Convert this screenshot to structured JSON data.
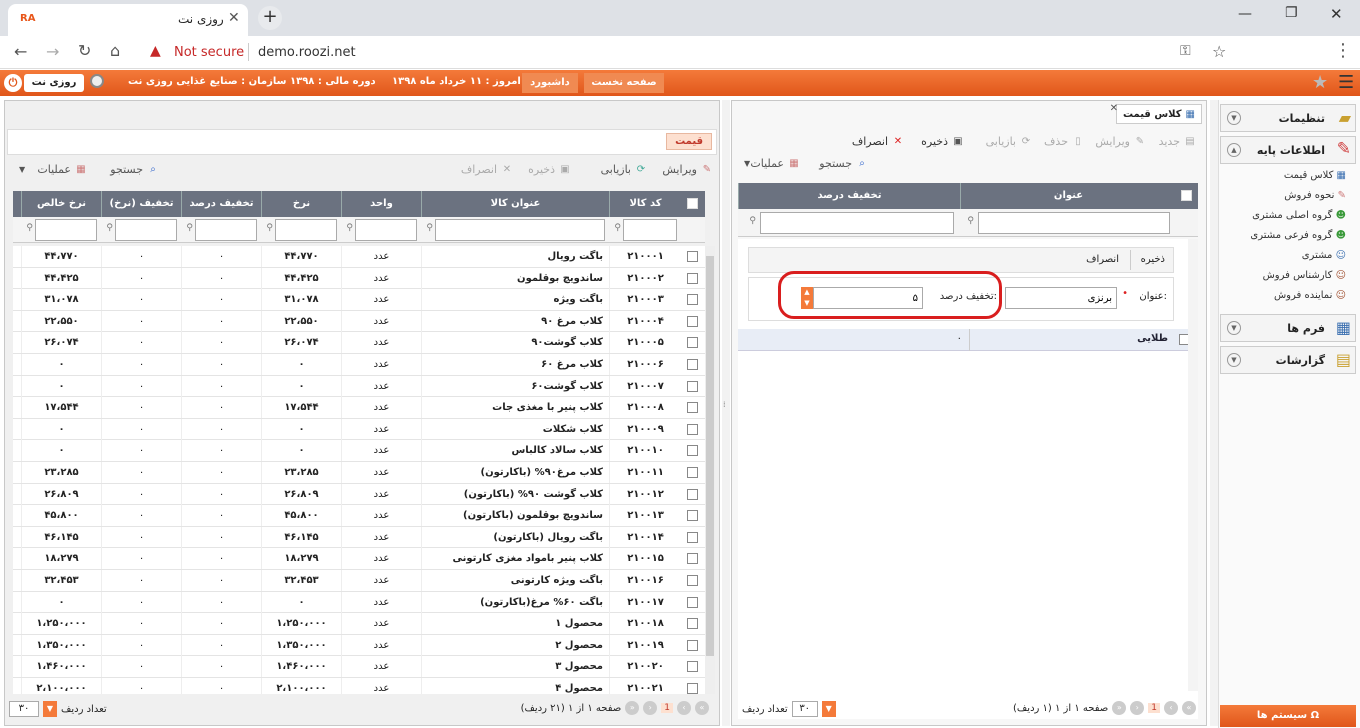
{
  "browser": {
    "tab_title": "روزی نت",
    "security": "Not secure",
    "url": "demo.roozi.net"
  },
  "header": {
    "user_label": "روزی نت",
    "org": "سازمان : صنایع غذایی روزی نت",
    "fiscal": "دوره مالی : ۱۳۹۸",
    "today": "امروز : ۱۱ خرداد ماه ۱۳۹۸",
    "dashboard": "داشبورد",
    "first_page": "صفحه نخست"
  },
  "sidebar": {
    "settings": "تنظیمات",
    "basic": "اطلاعات پایه",
    "items": [
      "کلاس قیمت",
      "نحوه فروش",
      "گروه اصلی مشتری",
      "گروه فرعی مشتری",
      "مشتری",
      "کارشناس فروش",
      "نماینده فروش"
    ],
    "forms": "فرم ها",
    "reports": "گزارشات",
    "system_menu": "سیستم ها"
  },
  "mid": {
    "tab": "کلاس قیمت",
    "tb": {
      "new": "جدید",
      "edit": "ویرایش",
      "delete": "حذف",
      "refresh": "بازیابی",
      "save": "ذخیره",
      "cancel": "انصراف",
      "search": "جستجو",
      "ops": "عملیات"
    },
    "cols": {
      "title": "عنوان",
      "discount": "تخفیف درصد"
    },
    "form": {
      "save": "ذخیره",
      "cancel": "انصراف",
      "title_label": "عنوان:",
      "title_value": "برنزی",
      "disc_label": "تخفیف درصد:",
      "disc_value": "۵"
    },
    "row": {
      "title": "طلایی",
      "discount": "۰"
    },
    "paging": "صفحه ۱ از ۱ (۱ ردیف)",
    "page_num": "1",
    "rows_label": "تعداد ردیف",
    "rows_value": "۳۰"
  },
  "left": {
    "title": "قیمت",
    "tb": {
      "edit": "ویرایش",
      "refresh": "بازیابی",
      "save": "ذخیره",
      "cancel": "انصراف",
      "search": "جستجو",
      "ops": "عملیات"
    },
    "cols": [
      "کد کالا",
      "عنوان کالا",
      "واحد",
      "نرخ",
      "تخفیف درصد",
      "تخفیف (نرخ)",
      "نرخ خالص"
    ],
    "rows": [
      [
        "۲۱۰۰۰۱",
        "باگت رویال",
        "عدد",
        "۴۴،۷۷۰",
        "۰",
        "۰",
        "۴۴،۷۷۰"
      ],
      [
        "۲۱۰۰۰۲",
        "ساندویچ بوقلمون",
        "عدد",
        "۴۴،۴۲۵",
        "۰",
        "۰",
        "۴۴،۴۲۵"
      ],
      [
        "۲۱۰۰۰۳",
        "باگت ویژه",
        "عدد",
        "۳۱،۰۷۸",
        "۰",
        "۰",
        "۳۱،۰۷۸"
      ],
      [
        "۲۱۰۰۰۴",
        "کلاب مرغ ۹۰",
        "عدد",
        "۲۲،۵۵۰",
        "۰",
        "۰",
        "۲۲،۵۵۰"
      ],
      [
        "۲۱۰۰۰۵",
        "کلاب گوشت۹۰",
        "عدد",
        "۲۶،۰۷۴",
        "۰",
        "۰",
        "۲۶،۰۷۴"
      ],
      [
        "۲۱۰۰۰۶",
        "کلاب مرغ ۶۰",
        "عدد",
        "۰",
        "۰",
        "۰",
        "۰"
      ],
      [
        "۲۱۰۰۰۷",
        "کلاب گوشت۶۰",
        "عدد",
        "۰",
        "۰",
        "۰",
        "۰"
      ],
      [
        "۲۱۰۰۰۸",
        "کلاب پنیر با مغذی جات",
        "عدد",
        "۱۷،۵۴۴",
        "۰",
        "۰",
        "۱۷،۵۴۴"
      ],
      [
        "۲۱۰۰۰۹",
        "کلاب شکلات",
        "عدد",
        "۰",
        "۰",
        "۰",
        "۰"
      ],
      [
        "۲۱۰۰۱۰",
        "کلاب سالاد کالباس",
        "عدد",
        "۰",
        "۰",
        "۰",
        "۰"
      ],
      [
        "۲۱۰۰۱۱",
        "کلاب مرغ۹۰% (باکارتون)",
        "عدد",
        "۲۳،۲۸۵",
        "۰",
        "۰",
        "۲۳،۲۸۵"
      ],
      [
        "۲۱۰۰۱۲",
        "کلاب گوشت ۹۰% (باکارتون)",
        "عدد",
        "۲۶،۸۰۹",
        "۰",
        "۰",
        "۲۶،۸۰۹"
      ],
      [
        "۲۱۰۰۱۳",
        "ساندویچ بوقلمون (باکارتون)",
        "عدد",
        "۴۵،۸۰۰",
        "۰",
        "۰",
        "۴۵،۸۰۰"
      ],
      [
        "۲۱۰۰۱۴",
        "باگت رویال (باکارتون)",
        "عدد",
        "۴۶،۱۴۵",
        "۰",
        "۰",
        "۴۶،۱۴۵"
      ],
      [
        "۲۱۰۰۱۵",
        "کلاب پنیر بامواد مغزی کارتونی",
        "عدد",
        "۱۸،۲۷۹",
        "۰",
        "۰",
        "۱۸،۲۷۹"
      ],
      [
        "۲۱۰۰۱۶",
        "باگت ویژه کارتونی",
        "عدد",
        "۳۲،۴۵۳",
        "۰",
        "۰",
        "۳۲،۴۵۳"
      ],
      [
        "۲۱۰۰۱۷",
        "باگت ۶۰% مرغ(باکارتون)",
        "عدد",
        "۰",
        "۰",
        "۰",
        "۰"
      ],
      [
        "۲۱۰۰۱۸",
        "محصول ۱",
        "عدد",
        "۱،۲۵۰،۰۰۰",
        "۰",
        "۰",
        "۱،۲۵۰،۰۰۰"
      ],
      [
        "۲۱۰۰۱۹",
        "محصول ۲",
        "عدد",
        "۱،۳۵۰،۰۰۰",
        "۰",
        "۰",
        "۱،۳۵۰،۰۰۰"
      ],
      [
        "۲۱۰۰۲۰",
        "محصول ۳",
        "عدد",
        "۱،۴۶۰،۰۰۰",
        "۰",
        "۰",
        "۱،۴۶۰،۰۰۰"
      ],
      [
        "۲۱۰۰۲۱",
        "محصول ۴",
        "عدد",
        "۲،۱۰۰،۰۰۰",
        "۰",
        "۰",
        "۲،۱۰۰،۰۰۰"
      ]
    ],
    "paging": "صفحه ۱ از ۱ (۲۱ ردیف)",
    "page_num": "1",
    "rows_label": "تعداد ردیف",
    "rows_value": "۳۰"
  }
}
